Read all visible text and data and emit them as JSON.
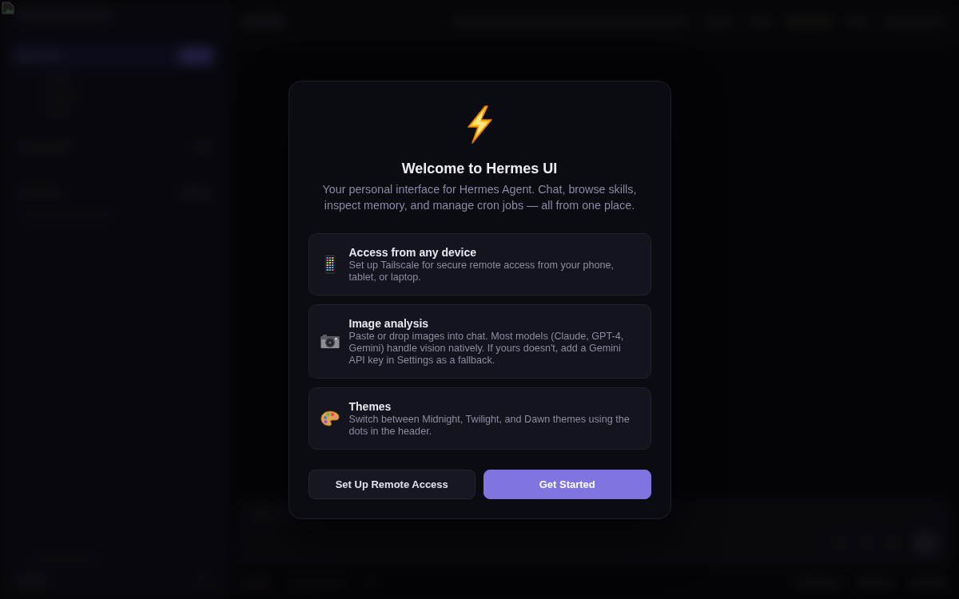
{
  "dialog": {
    "title": "Welcome to Hermes UI",
    "subtitle": "Your personal interface for Hermes Agent. Chat, browse skills, inspect memory, and manage cron jobs — all from one place.",
    "features": [
      {
        "title": "Access from any device",
        "description": "Set up Tailscale for secure remote access from your phone, tablet, or laptop."
      },
      {
        "title": "Image analysis",
        "description": "Paste or drop images into chat. Most models (Claude, GPT-4, Gemini) handle vision natively. If yours doesn't, add a Gemini API key in Settings as a fallback."
      },
      {
        "title": "Themes",
        "description": "Switch between Midnight, Twilight, and Dawn themes using the dots in the header."
      }
    ],
    "buttons": [
      {
        "label": "Set Up Remote Access",
        "kind": "secondary"
      },
      {
        "label": "Get Started",
        "kind": "primary"
      }
    ]
  }
}
